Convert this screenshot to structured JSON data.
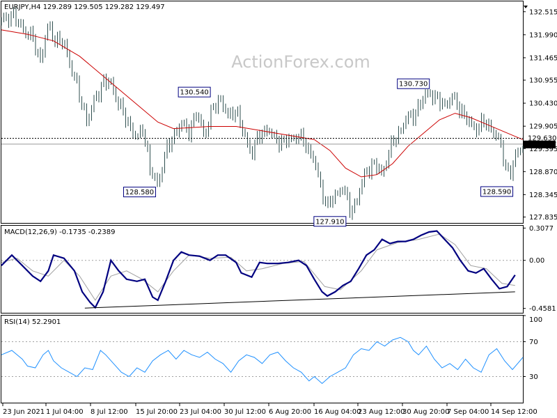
{
  "chart_data": [
    {
      "type": "candlestick",
      "panel": "price",
      "header": {
        "symbol": "EURJPY,H4",
        "open": "129.289",
        "high": "129.505",
        "low": "129.282",
        "close": "129.497"
      },
      "watermark": "ActionForex.com",
      "ylim": [
        127.7,
        132.75
      ],
      "y_ticks": [
        132.515,
        131.99,
        131.465,
        130.955,
        130.43,
        129.905,
        129.395,
        128.87,
        128.345,
        127.835
      ],
      "y_tick_labels": [
        "132.515",
        "131.990",
        "131.465",
        "130.955",
        "130.430",
        "129.905",
        "129.395",
        "128.870",
        "128.345",
        "127.835"
      ],
      "current_price": 129.497,
      "current_price_label": "129.497",
      "level_line": 129.63,
      "level_line_label": "129.630",
      "annotations": [
        {
          "text": "130.540",
          "x": 0.37,
          "y": 130.54
        },
        {
          "text": "128.580",
          "x": 0.265,
          "y": 128.58
        },
        {
          "text": "127.910",
          "x": 0.63,
          "y": 127.91
        },
        {
          "text": "130.730",
          "x": 0.79,
          "y": 130.73
        },
        {
          "text": "128.590",
          "x": 0.95,
          "y": 128.59
        }
      ],
      "close_path": [
        [
          0.0,
          132.3
        ],
        [
          0.02,
          132.45
        ],
        [
          0.04,
          132.15
        ],
        [
          0.06,
          131.9
        ],
        [
          0.075,
          131.4
        ],
        [
          0.09,
          132.2
        ],
        [
          0.105,
          131.85
        ],
        [
          0.12,
          131.8
        ],
        [
          0.135,
          131.2
        ],
        [
          0.15,
          130.6
        ],
        [
          0.165,
          130.0
        ],
        [
          0.18,
          130.55
        ],
        [
          0.195,
          130.9
        ],
        [
          0.21,
          130.9
        ],
        [
          0.225,
          130.4
        ],
        [
          0.245,
          129.95
        ],
        [
          0.26,
          129.6
        ],
        [
          0.272,
          129.9
        ],
        [
          0.285,
          128.9
        ],
        [
          0.3,
          128.58
        ],
        [
          0.315,
          129.3
        ],
        [
          0.33,
          129.7
        ],
        [
          0.345,
          129.95
        ],
        [
          0.36,
          129.8
        ],
        [
          0.375,
          130.2
        ],
        [
          0.39,
          129.7
        ],
        [
          0.405,
          130.3
        ],
        [
          0.42,
          130.54
        ],
        [
          0.435,
          130.1
        ],
        [
          0.45,
          130.3
        ],
        [
          0.465,
          129.7
        ],
        [
          0.48,
          129.3
        ],
        [
          0.495,
          129.7
        ],
        [
          0.51,
          129.85
        ],
        [
          0.525,
          129.6
        ],
        [
          0.54,
          129.55
        ],
        [
          0.555,
          129.6
        ],
        [
          0.57,
          129.7
        ],
        [
          0.585,
          129.45
        ],
        [
          0.6,
          129.15
        ],
        [
          0.612,
          128.5
        ],
        [
          0.625,
          128.1
        ],
        [
          0.64,
          128.3
        ],
        [
          0.655,
          128.55
        ],
        [
          0.67,
          127.91
        ],
        [
          0.685,
          128.35
        ],
        [
          0.7,
          128.9
        ],
        [
          0.715,
          129.05
        ],
        [
          0.73,
          128.8
        ],
        [
          0.745,
          129.4
        ],
        [
          0.76,
          129.7
        ],
        [
          0.775,
          130.05
        ],
        [
          0.79,
          130.15
        ],
        [
          0.805,
          130.45
        ],
        [
          0.82,
          130.7
        ],
        [
          0.835,
          130.5
        ],
        [
          0.85,
          130.4
        ],
        [
          0.865,
          130.55
        ],
        [
          0.88,
          130.3
        ],
        [
          0.895,
          130.0
        ],
        [
          0.91,
          129.85
        ],
        [
          0.925,
          130.0
        ],
        [
          0.94,
          129.85
        ],
        [
          0.955,
          129.55
        ],
        [
          0.965,
          129.1
        ],
        [
          0.975,
          128.75
        ],
        [
          0.985,
          129.2
        ],
        [
          1.0,
          129.5
        ]
      ],
      "ma_path": [
        [
          0.0,
          132.1
        ],
        [
          0.05,
          132.0
        ],
        [
          0.1,
          131.85
        ],
        [
          0.15,
          131.5
        ],
        [
          0.2,
          131.0
        ],
        [
          0.25,
          130.5
        ],
        [
          0.3,
          130.0
        ],
        [
          0.33,
          129.85
        ],
        [
          0.4,
          129.9
        ],
        [
          0.45,
          129.9
        ],
        [
          0.5,
          129.8
        ],
        [
          0.55,
          129.7
        ],
        [
          0.6,
          129.6
        ],
        [
          0.63,
          129.35
        ],
        [
          0.66,
          128.95
        ],
        [
          0.69,
          128.75
        ],
        [
          0.72,
          128.8
        ],
        [
          0.75,
          129.05
        ],
        [
          0.78,
          129.45
        ],
        [
          0.81,
          129.75
        ],
        [
          0.84,
          130.05
        ],
        [
          0.87,
          130.2
        ],
        [
          0.9,
          130.1
        ],
        [
          0.93,
          129.95
        ],
        [
          0.96,
          129.8
        ],
        [
          1.0,
          129.6
        ]
      ]
    },
    {
      "type": "line",
      "panel": "macd",
      "header": "MACD(12,26,9) -0.1735 -0.2389",
      "ylim": [
        -0.5,
        0.33
      ],
      "y_ticks": [
        0.3077,
        0.0,
        -0.4581
      ],
      "y_tick_labels": [
        "0.3077",
        "0.00",
        "-0.4581"
      ],
      "macd_path": [
        [
          0.0,
          -0.05
        ],
        [
          0.02,
          0.05
        ],
        [
          0.04,
          -0.05
        ],
        [
          0.06,
          -0.15
        ],
        [
          0.075,
          -0.2
        ],
        [
          0.09,
          -0.1
        ],
        [
          0.1,
          0.05
        ],
        [
          0.12,
          0.02
        ],
        [
          0.14,
          -0.1
        ],
        [
          0.155,
          -0.3
        ],
        [
          0.17,
          -0.4
        ],
        [
          0.18,
          -0.45
        ],
        [
          0.195,
          -0.3
        ],
        [
          0.21,
          0.0
        ],
        [
          0.225,
          -0.1
        ],
        [
          0.24,
          -0.18
        ],
        [
          0.26,
          -0.2
        ],
        [
          0.275,
          -0.18
        ],
        [
          0.29,
          -0.35
        ],
        [
          0.3,
          -0.38
        ],
        [
          0.315,
          -0.2
        ],
        [
          0.33,
          0.0
        ],
        [
          0.345,
          0.08
        ],
        [
          0.36,
          0.05
        ],
        [
          0.38,
          0.04
        ],
        [
          0.4,
          0.0
        ],
        [
          0.415,
          0.05
        ],
        [
          0.43,
          0.05
        ],
        [
          0.45,
          -0.02
        ],
        [
          0.46,
          -0.12
        ],
        [
          0.48,
          -0.16
        ],
        [
          0.495,
          -0.02
        ],
        [
          0.51,
          -0.03
        ],
        [
          0.53,
          -0.03
        ],
        [
          0.55,
          -0.02
        ],
        [
          0.57,
          0.0
        ],
        [
          0.585,
          -0.05
        ],
        [
          0.6,
          -0.18
        ],
        [
          0.615,
          -0.3
        ],
        [
          0.625,
          -0.34
        ],
        [
          0.64,
          -0.3
        ],
        [
          0.655,
          -0.24
        ],
        [
          0.67,
          -0.2
        ],
        [
          0.685,
          -0.08
        ],
        [
          0.7,
          0.05
        ],
        [
          0.715,
          0.1
        ],
        [
          0.73,
          0.2
        ],
        [
          0.745,
          0.16
        ],
        [
          0.76,
          0.18
        ],
        [
          0.775,
          0.18
        ],
        [
          0.79,
          0.2
        ],
        [
          0.805,
          0.24
        ],
        [
          0.82,
          0.27
        ],
        [
          0.835,
          0.28
        ],
        [
          0.85,
          0.2
        ],
        [
          0.865,
          0.12
        ],
        [
          0.88,
          0.0
        ],
        [
          0.895,
          -0.1
        ],
        [
          0.91,
          -0.12
        ],
        [
          0.925,
          -0.08
        ],
        [
          0.94,
          -0.18
        ],
        [
          0.955,
          -0.27
        ],
        [
          0.97,
          -0.25
        ],
        [
          0.985,
          -0.14
        ]
      ],
      "signal_path": [
        [
          0.0,
          -0.02
        ],
        [
          0.03,
          0.02
        ],
        [
          0.06,
          -0.1
        ],
        [
          0.09,
          -0.15
        ],
        [
          0.12,
          0.0
        ],
        [
          0.15,
          -0.15
        ],
        [
          0.18,
          -0.38
        ],
        [
          0.21,
          -0.15
        ],
        [
          0.24,
          -0.1
        ],
        [
          0.27,
          -0.18
        ],
        [
          0.3,
          -0.3
        ],
        [
          0.33,
          -0.1
        ],
        [
          0.36,
          0.05
        ],
        [
          0.4,
          0.02
        ],
        [
          0.44,
          0.03
        ],
        [
          0.47,
          -0.1
        ],
        [
          0.5,
          -0.08
        ],
        [
          0.54,
          -0.03
        ],
        [
          0.58,
          -0.01
        ],
        [
          0.62,
          -0.25
        ],
        [
          0.65,
          -0.28
        ],
        [
          0.69,
          -0.1
        ],
        [
          0.72,
          0.1
        ],
        [
          0.76,
          0.17
        ],
        [
          0.8,
          0.2
        ],
        [
          0.84,
          0.25
        ],
        [
          0.87,
          0.15
        ],
        [
          0.9,
          -0.05
        ],
        [
          0.93,
          -0.08
        ],
        [
          0.96,
          -0.22
        ],
        [
          0.985,
          -0.24
        ]
      ],
      "trendline": [
        [
          0.16,
          -0.455
        ],
        [
          0.985,
          -0.3
        ]
      ]
    },
    {
      "type": "line",
      "panel": "rsi",
      "header": "RSI(14) 52.2901",
      "ylim": [
        0,
        100
      ],
      "y_ticks": [
        100,
        70,
        30
      ],
      "y_tick_labels": [
        "100",
        "70",
        "30"
      ],
      "levels": [
        70,
        30
      ],
      "rsi_path": [
        [
          0.0,
          55
        ],
        [
          0.02,
          60
        ],
        [
          0.04,
          50
        ],
        [
          0.05,
          42
        ],
        [
          0.065,
          40
        ],
        [
          0.08,
          55
        ],
        [
          0.09,
          60
        ],
        [
          0.1,
          48
        ],
        [
          0.115,
          40
        ],
        [
          0.13,
          35
        ],
        [
          0.145,
          30
        ],
        [
          0.16,
          40
        ],
        [
          0.175,
          38
        ],
        [
          0.19,
          60
        ],
        [
          0.2,
          55
        ],
        [
          0.215,
          45
        ],
        [
          0.23,
          35
        ],
        [
          0.245,
          30
        ],
        [
          0.26,
          40
        ],
        [
          0.275,
          35
        ],
        [
          0.29,
          48
        ],
        [
          0.305,
          55
        ],
        [
          0.32,
          60
        ],
        [
          0.335,
          50
        ],
        [
          0.35,
          60
        ],
        [
          0.365,
          55
        ],
        [
          0.38,
          52
        ],
        [
          0.395,
          58
        ],
        [
          0.41,
          50
        ],
        [
          0.425,
          45
        ],
        [
          0.44,
          35
        ],
        [
          0.455,
          48
        ],
        [
          0.47,
          55
        ],
        [
          0.485,
          52
        ],
        [
          0.5,
          45
        ],
        [
          0.515,
          55
        ],
        [
          0.53,
          58
        ],
        [
          0.545,
          48
        ],
        [
          0.56,
          40
        ],
        [
          0.575,
          35
        ],
        [
          0.59,
          25
        ],
        [
          0.6,
          30
        ],
        [
          0.615,
          22
        ],
        [
          0.63,
          30
        ],
        [
          0.645,
          35
        ],
        [
          0.66,
          40
        ],
        [
          0.675,
          55
        ],
        [
          0.69,
          62
        ],
        [
          0.705,
          60
        ],
        [
          0.72,
          70
        ],
        [
          0.735,
          65
        ],
        [
          0.75,
          72
        ],
        [
          0.765,
          75
        ],
        [
          0.78,
          70
        ],
        [
          0.79,
          60
        ],
        [
          0.8,
          55
        ],
        [
          0.815,
          65
        ],
        [
          0.83,
          50
        ],
        [
          0.845,
          40
        ],
        [
          0.86,
          45
        ],
        [
          0.875,
          38
        ],
        [
          0.89,
          50
        ],
        [
          0.905,
          40
        ],
        [
          0.92,
          35
        ],
        [
          0.935,
          55
        ],
        [
          0.95,
          62
        ],
        [
          0.965,
          48
        ],
        [
          0.98,
          38
        ],
        [
          0.99,
          45
        ],
        [
          1.0,
          52
        ]
      ],
      "x_tick_labels": [
        "23 Jun 2021",
        "1 Jul 04:00",
        "8 Jul 12:00",
        "15 Jul 20:00",
        "23 Jul 04:00",
        "30 Jul 12:00",
        "6 Aug 20:00",
        "16 Aug 04:00",
        "23 Aug 12:00",
        "30 Aug 20:00",
        "7 Sep 04:00",
        "14 Sep 12:00"
      ]
    }
  ],
  "colors": {
    "bars": "#2f4f4f",
    "ma": "#cc0000",
    "macd": "#000080",
    "signal": "#a0a0a0",
    "grid": "#a0a0a0",
    "label_border": "#000080",
    "watermark": "#c8c8c8"
  }
}
